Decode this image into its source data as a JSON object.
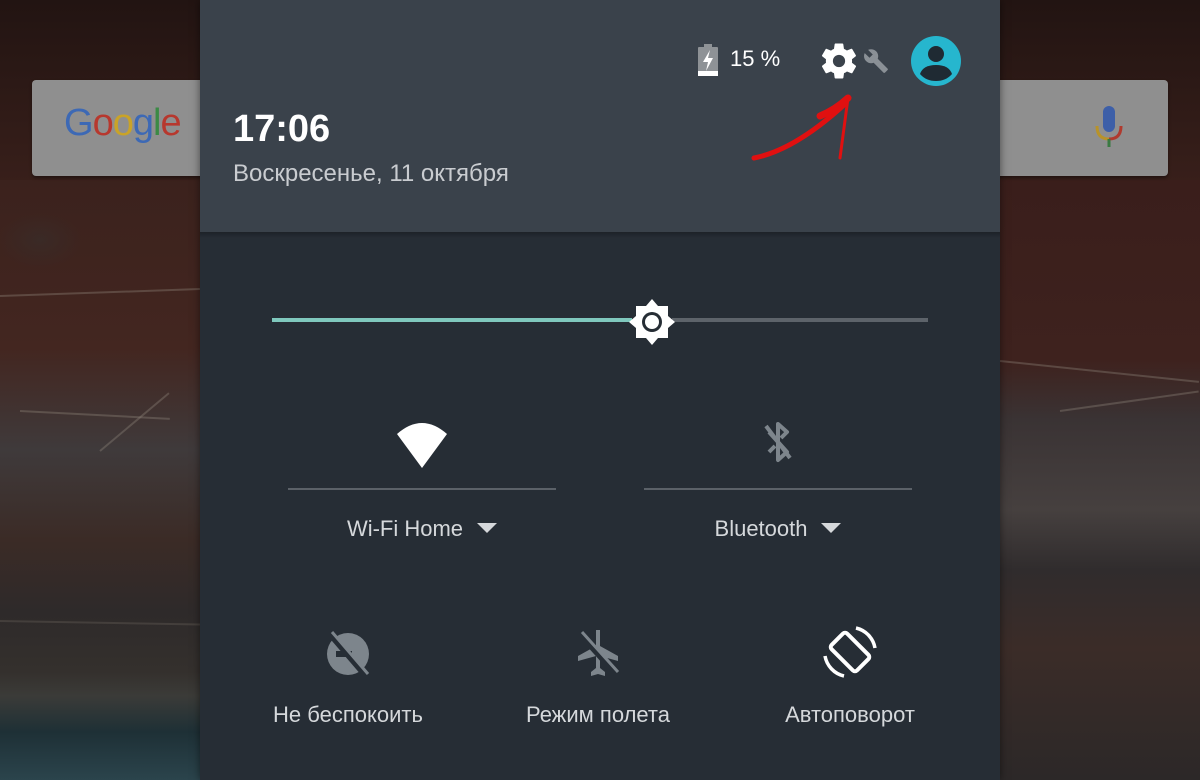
{
  "status_bar": {
    "battery_percent": "15 %",
    "battery_level": 0.15,
    "battery_charging": true
  },
  "header": {
    "time": "17:06",
    "date": "Воскресенье, 11 октября",
    "settings_icon": "gear-icon",
    "settings_badge_icon": "wrench-icon",
    "user_icon": "account-circle-icon"
  },
  "annotation": {
    "type": "arrow",
    "color": "#e01010",
    "points_to": "settings-button"
  },
  "background": {
    "search_widget_logo": "Google",
    "search_widget_mic": "microphone-icon"
  },
  "brightness": {
    "level_percent": 58,
    "icon": "brightness-auto-sun-icon"
  },
  "tiles_primary": [
    {
      "id": "wifi",
      "label": "Wi-Fi Home",
      "icon": "wifi-icon",
      "active": true,
      "has_dropdown": true
    },
    {
      "id": "bluetooth",
      "label": "Bluetooth",
      "icon": "bluetooth-disabled-icon",
      "active": false,
      "has_dropdown": true
    }
  ],
  "tiles_secondary": [
    {
      "id": "dnd",
      "label": "Не беспокоить",
      "icon": "do-not-disturb-off-icon",
      "active": false
    },
    {
      "id": "airplane",
      "label": "Режим полета",
      "icon": "airplane-off-icon",
      "active": false
    },
    {
      "id": "autorotate",
      "label": "Автоповорот",
      "icon": "screen-rotation-icon",
      "active": true
    }
  ],
  "colors": {
    "panel_bg": "#262d35",
    "header_bg": "#3a424b",
    "accent": "#7fc8bd",
    "avatar": "#26b6ce",
    "icon_active": "#ffffff",
    "icon_inactive": "#7d858c"
  }
}
